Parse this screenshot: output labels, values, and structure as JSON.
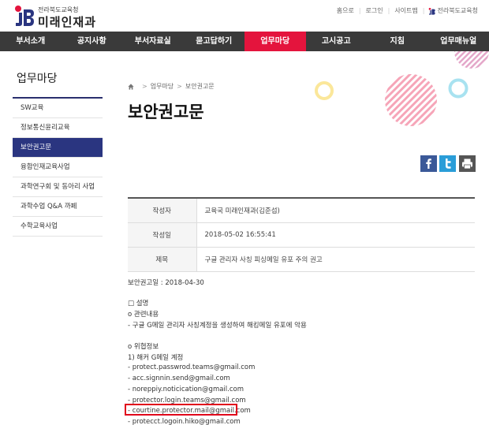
{
  "header": {
    "logo_sub": "전라북도교육청",
    "logo_main": "미래인재과",
    "util_links": [
      "홈으로",
      "로그인",
      "사이트맵"
    ],
    "util_logo_text": "전라북도교육청"
  },
  "nav": {
    "items": [
      "부서소개",
      "공지사항",
      "부서자료실",
      "묻고답하기",
      "업무마당",
      "고시공고",
      "지침",
      "업무매뉴얼"
    ],
    "active_index": 4
  },
  "sidebar": {
    "title": "업무마당",
    "items": [
      "SW교육",
      "정보통신윤리교육",
      "보안권고문",
      "융합인재교육사업",
      "과학연구회 및 동아리 사업",
      "과학수업 Q&A 까페",
      "수학교육사업"
    ],
    "active_index": 2
  },
  "breadcrumb": [
    "업무마당",
    "보안권고문"
  ],
  "page_title": "보안권고문",
  "share": {
    "facebook_icon": "facebook-icon",
    "twitter_icon": "twitter-icon",
    "print_icon": "print-icon"
  },
  "info": {
    "author_label": "작성자",
    "author_value": "교육국 미래인재과(김준섭)",
    "date_label": "작성일",
    "date_value": "2018-05-02 16:55:41",
    "subject_label": "제목",
    "subject_value": "구글 관리자 사칭 피싱메일 유포 주의 권고"
  },
  "body": {
    "lines": [
      "보안권고일 : 2018-04-30",
      "□ 설명",
      "o 관련내용",
      " - 구글 G메일 관리자 사칭계정을 생성하여 해킹메일 유포에 악용",
      "o 위협정보",
      "1) 해커 G메일 계정",
      "- protect.passwrod.teams@gmail.com",
      "- acc.signnin.send@gmail.com",
      "- noreppiy.noticication@gmail.com",
      "- protector.login.teams@gmail.com",
      "- courtine.protector.mail@gmail.com",
      "- protecct.logoin.hiko@gmail.com"
    ]
  },
  "colors": {
    "nav_bg": "#3a3a3a",
    "nav_active": "#e4143d",
    "side_active": "#2a3580",
    "highlight": "#e0001b"
  }
}
